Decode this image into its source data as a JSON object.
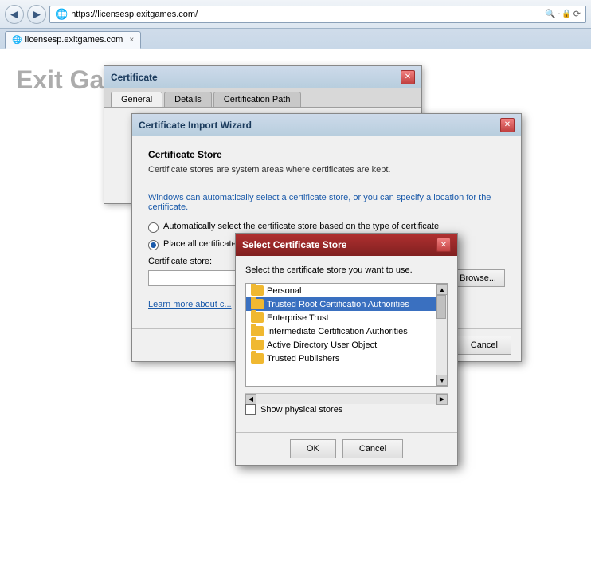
{
  "browser": {
    "back_title": "Back",
    "forward_title": "Forward",
    "address": "https://licensesp.exitgames.com/",
    "tab_title": "licensesp.exitgames.com",
    "tab_close": "×",
    "refresh": "⟳",
    "lock_icon": "🔒"
  },
  "page": {
    "title": "Exit Ga..."
  },
  "cert_dialog": {
    "title": "Certificate",
    "close": "✕",
    "tabs": [
      "General",
      "Details",
      "Certification Path"
    ]
  },
  "wizard_dialog": {
    "title": "Certificate Import Wizard",
    "close": "✕",
    "section_title": "Certificate Store",
    "description": "Certificate stores are system areas where certificates are kept.",
    "info_text": "Windows can automatically select a certificate store, or you can specify a location for\nthe certificate.",
    "radio1": "Automatically select the certificate store based on the type of certificate",
    "radio2": "Place all certificates in the following store",
    "cert_store_label": "Certificate store:",
    "browse_label": "Browse...",
    "learn_more": "Learn more about c...",
    "cancel_label": "Cancel"
  },
  "select_store_dialog": {
    "title": "Select Certificate Store",
    "close": "✕",
    "description": "Select the certificate store you want to use.",
    "items": [
      {
        "label": "Personal",
        "selected": false
      },
      {
        "label": "Trusted Root Certification Authorities",
        "selected": true
      },
      {
        "label": "Enterprise Trust",
        "selected": false
      },
      {
        "label": "Intermediate Certification Authorities",
        "selected": false
      },
      {
        "label": "Active Directory User Object",
        "selected": false
      },
      {
        "label": "Trusted Publishers",
        "selected": false
      }
    ],
    "show_physical": "Show physical stores",
    "ok_label": "OK",
    "cancel_label": "Cancel"
  }
}
